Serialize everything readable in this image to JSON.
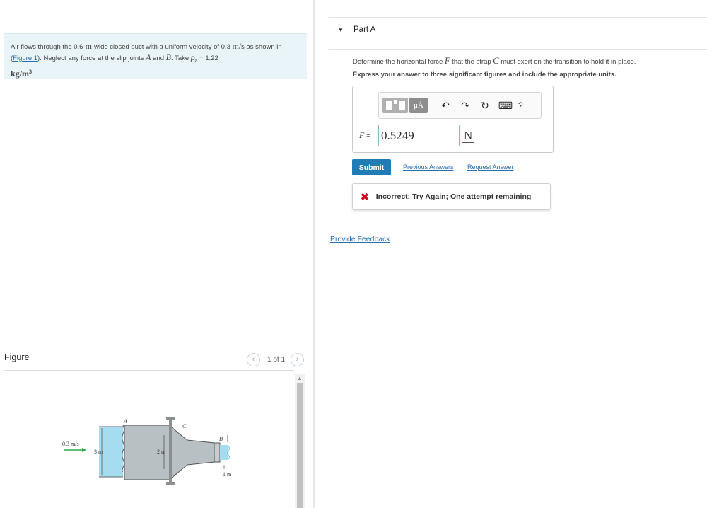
{
  "problem": {
    "t1": "Air flows through the 0.6-",
    "u1": "m",
    "t2": "-wide closed duct with a uniform velocity of 0.3 ",
    "u2": "m/s",
    "t3": " as shown in (",
    "figure_link": "Figure 1",
    "t4": "). Neglect any force at the slip joints ",
    "a": "A",
    "t5": " and ",
    "b": "B",
    "t6": ". Take ",
    "rho": "ρ",
    "rho_sub": "a",
    "t7": " = 1.22 ",
    "density_unit": "kg/m",
    "density_exp": "3",
    "t8": "."
  },
  "figure": {
    "title": "Figure",
    "counter": "1 of 1",
    "labels": {
      "velocity": "0.3 m/s",
      "h_inlet": "3 m",
      "h_mid": "2 m",
      "h_outlet": "1 m",
      "joint_a": "A",
      "joint_b": "B",
      "strap_c": "C"
    }
  },
  "part": {
    "label": "Part A",
    "q1": "Determine the horizontal force ",
    "q_f": "F",
    "q2": " that the strap ",
    "q_c": "C",
    "q3": " must exert on the transition to hold it in place.",
    "instruction": "Express your answer to three significant figures and include the appropriate units."
  },
  "toolbar": {
    "mu_label": "μÅ",
    "undo_icon": "↶",
    "redo_icon": "↷",
    "reset_icon": "↻",
    "keyboard_icon": "⌨",
    "help_label": "?"
  },
  "answer": {
    "variable": "F",
    "equals": " =",
    "value": "0.5249",
    "unit": "N"
  },
  "actions": {
    "submit": "Submit",
    "previous": "Previous Answers",
    "request": "Request Answer"
  },
  "feedback": {
    "icon": "✖",
    "message": "Incorrect; Try Again; One attempt remaining"
  },
  "provide_feedback": "Provide Feedback",
  "colors": {
    "accent": "#1f7cb5",
    "error": "#d0021b",
    "problem_bg": "#e8f4f8",
    "water": "#a6dcef",
    "arrow_green": "#2ea84f"
  }
}
